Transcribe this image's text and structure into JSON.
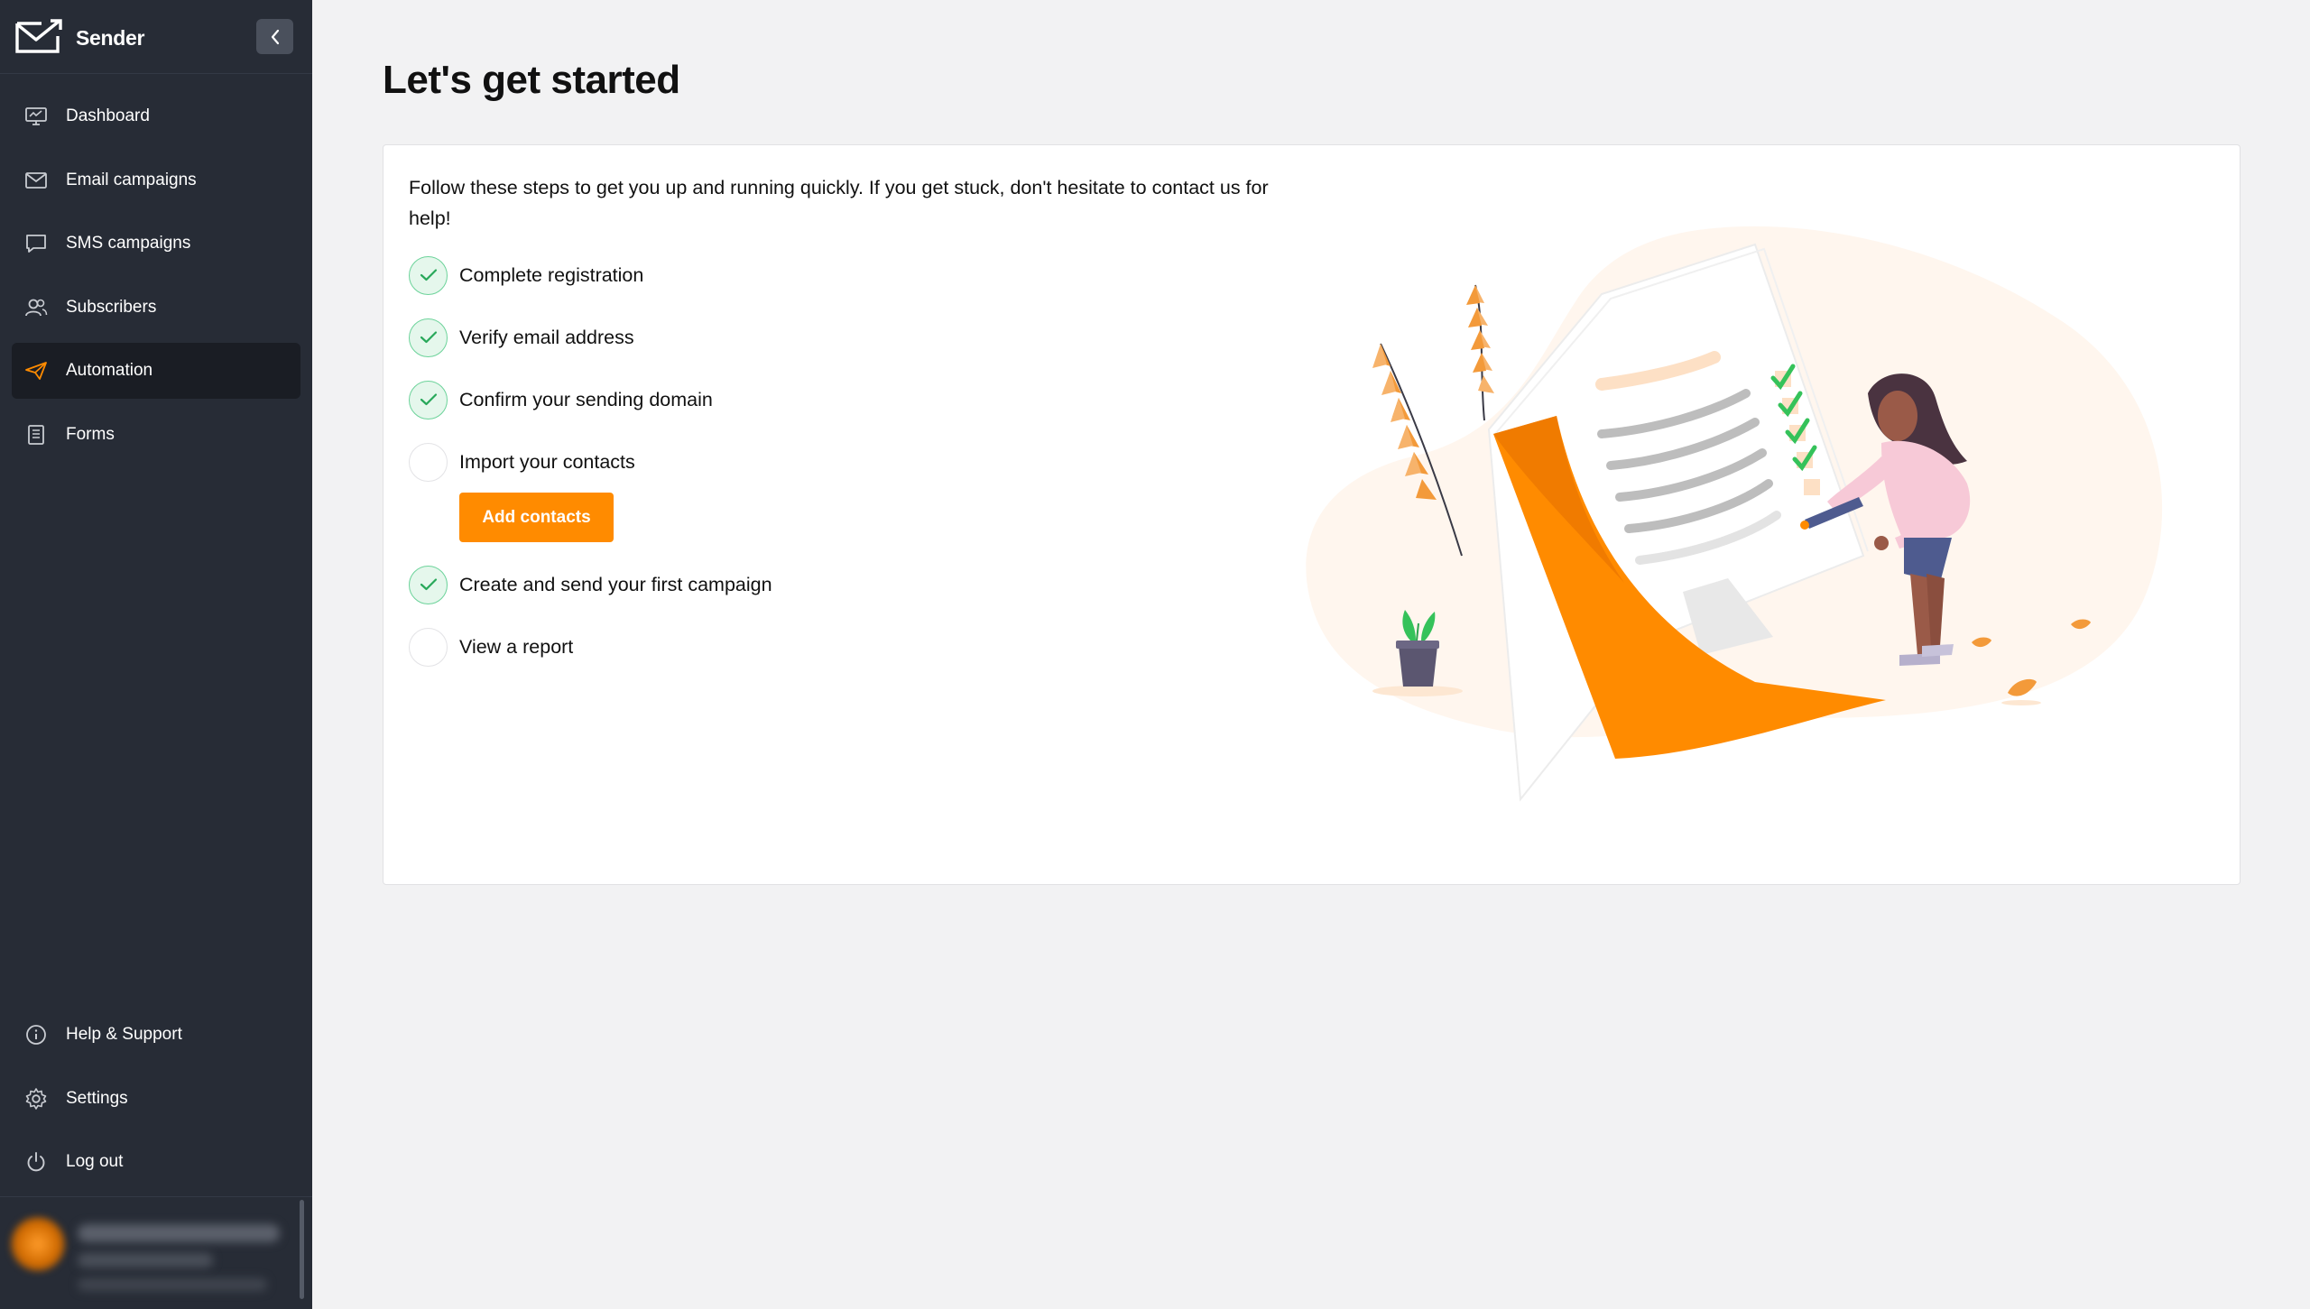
{
  "app": {
    "brand": "Sender"
  },
  "sidebar": {
    "items": [
      {
        "label": "Dashboard",
        "icon": "monitor-icon",
        "active": false
      },
      {
        "label": "Email campaigns",
        "icon": "envelope-icon",
        "active": false
      },
      {
        "label": "SMS campaigns",
        "icon": "chat-bubble-icon",
        "active": false
      },
      {
        "label": "Subscribers",
        "icon": "users-icon",
        "active": false
      },
      {
        "label": "Automation",
        "icon": "paper-plane-icon",
        "active": true
      },
      {
        "label": "Forms",
        "icon": "form-icon",
        "active": false
      }
    ],
    "bottom_items": [
      {
        "label": "Help & Support",
        "icon": "info-icon"
      },
      {
        "label": "Settings",
        "icon": "gear-icon"
      },
      {
        "label": "Log out",
        "icon": "power-icon"
      }
    ]
  },
  "main": {
    "title": "Let's get started",
    "intro": "Follow these steps to get you up and running quickly. If you get stuck, don't hesitate to contact us for help!",
    "steps": [
      {
        "label": "Complete registration",
        "done": true
      },
      {
        "label": "Verify email address",
        "done": true
      },
      {
        "label": "Confirm your sending domain",
        "done": true
      },
      {
        "label": "Import your contacts",
        "done": false
      },
      {
        "label": "Create and send your first campaign",
        "done": true
      },
      {
        "label": "View a report",
        "done": false
      }
    ],
    "add_contacts_label": "Add contacts"
  },
  "colors": {
    "accent": "#ff8b00",
    "sidebar_bg": "#272c36",
    "check_green": "#3fbf6e"
  }
}
